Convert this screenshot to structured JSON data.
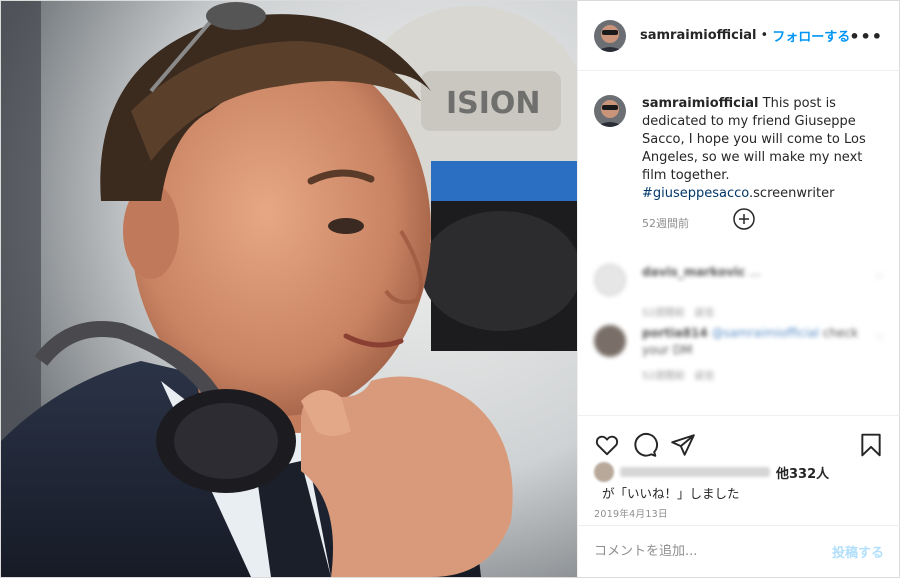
{
  "header": {
    "username": "samraimiofficial",
    "separator": "•",
    "follow_label": "フォローする",
    "more_icon": "more-horizontal-icon"
  },
  "caption": {
    "username": "samraimiofficial",
    "text": " This post is dedicated to my friend Giuseppe Sacco, I hope you will come to Los Angeles, so we will make my next film together. ",
    "hashtag": "#giuseppesacco",
    "text_after": ".screenwriter",
    "time": "52週間前"
  },
  "load_more_icon": "plus-circle-icon",
  "comments": [
    {
      "user": "davis_markovic",
      "text": "...",
      "meta_time": "52週間前",
      "meta_reply": "返信"
    },
    {
      "user": "portia814",
      "mention": "@samraimiofficial",
      "text": "check your DM",
      "meta_time": "52週間前",
      "meta_reply": "返信"
    }
  ],
  "actions": {
    "like_icon": "heart-icon",
    "comment_icon": "comment-icon",
    "share_icon": "paper-plane-icon",
    "save_icon": "bookmark-icon"
  },
  "likes": {
    "others": "他332人",
    "liked_text": "が「いいね！」しました",
    "date": "2019年4月13日"
  },
  "comment_box": {
    "placeholder": "コメントを追加...",
    "post_label": "投稿する"
  },
  "colors": {
    "accent": "#0095f6",
    "post_disabled": "#b2dffc",
    "hashtag": "#00376b",
    "muted": "#8e8e8e"
  }
}
